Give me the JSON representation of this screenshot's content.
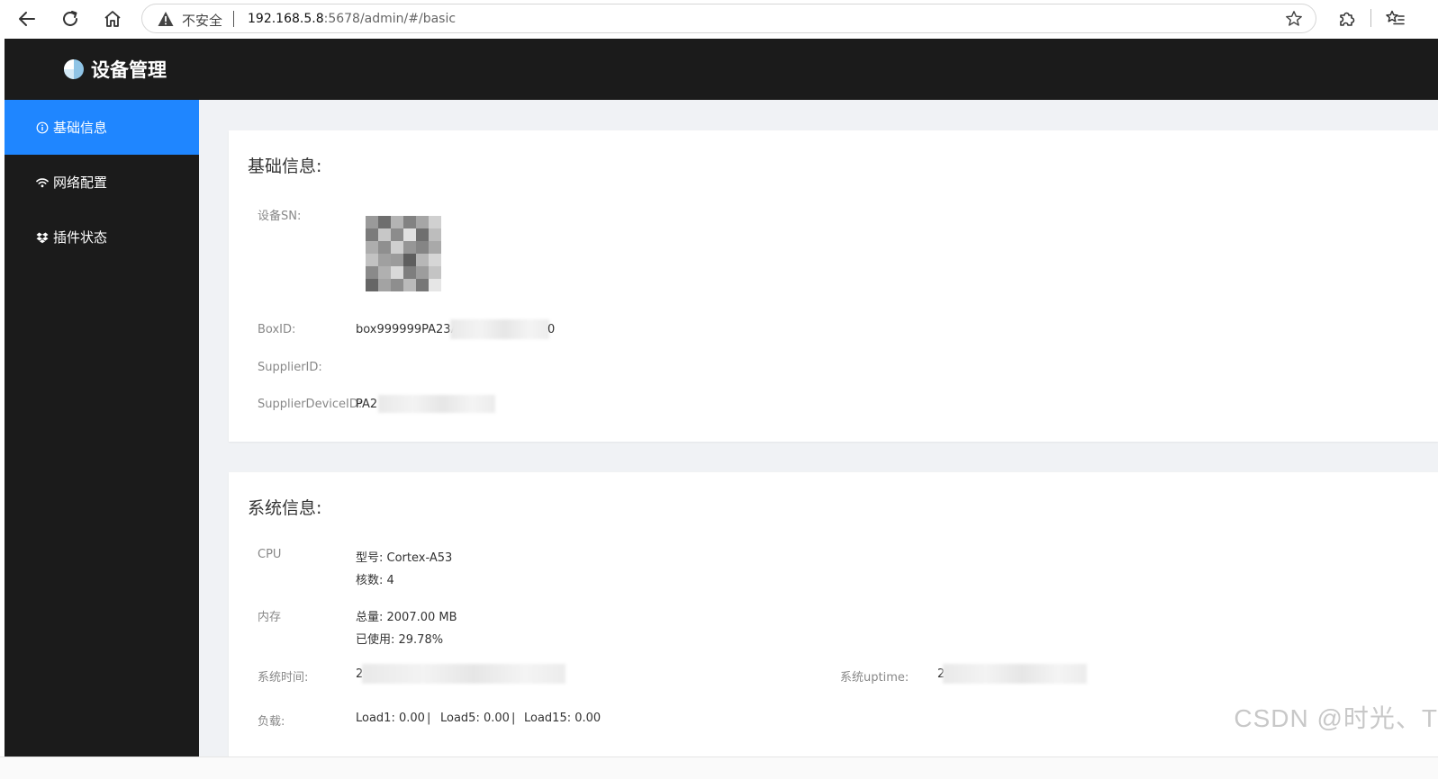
{
  "browser": {
    "security_label": "不安全",
    "url_host": "192.168.5.8",
    "url_path": ":5678/admin/#/basic"
  },
  "app": {
    "title": "设备管理"
  },
  "sidebar": {
    "items": [
      {
        "label": "基础信息",
        "icon": "info-circle-icon",
        "active": true
      },
      {
        "label": "网络配置",
        "icon": "wifi-icon",
        "active": false
      },
      {
        "label": "插件状态",
        "icon": "dropbox-icon",
        "active": false
      }
    ]
  },
  "basic_info": {
    "title": "基础信息:",
    "device_sn_label": "设备SN:",
    "boxid_label": "BoxID:",
    "boxid_value_start": "box999999PA23A",
    "boxid_value_end": "0",
    "supplierid_label": "SupplierID:",
    "supplier_device_id_label": "SupplierDeviceID:",
    "supplier_device_id_value_start": "PA2"
  },
  "system_info": {
    "title": "系统信息:",
    "cpu_label": "CPU",
    "cpu_model": "型号: Cortex-A53",
    "cpu_cores": "核数: 4",
    "memory_label": "内存",
    "memory_total": "总量: 2007.00 MB",
    "memory_used": "已使用: 29.78%",
    "system_time_label": "系统时间:",
    "system_time_value_start": "2",
    "uptime_label": "系统uptime:",
    "uptime_value_start": "2",
    "load_label": "负载:",
    "load1": "Load1: 0.00",
    "load5": "Load5: 0.00",
    "load15": "Load15: 0.00",
    "load_separator": "|"
  },
  "watermark": "CSDN @时光、T",
  "colors": {
    "header_bg": "#1b1b1b",
    "active_menu": "#1f86ff",
    "content_bg": "#f0f2f5"
  }
}
